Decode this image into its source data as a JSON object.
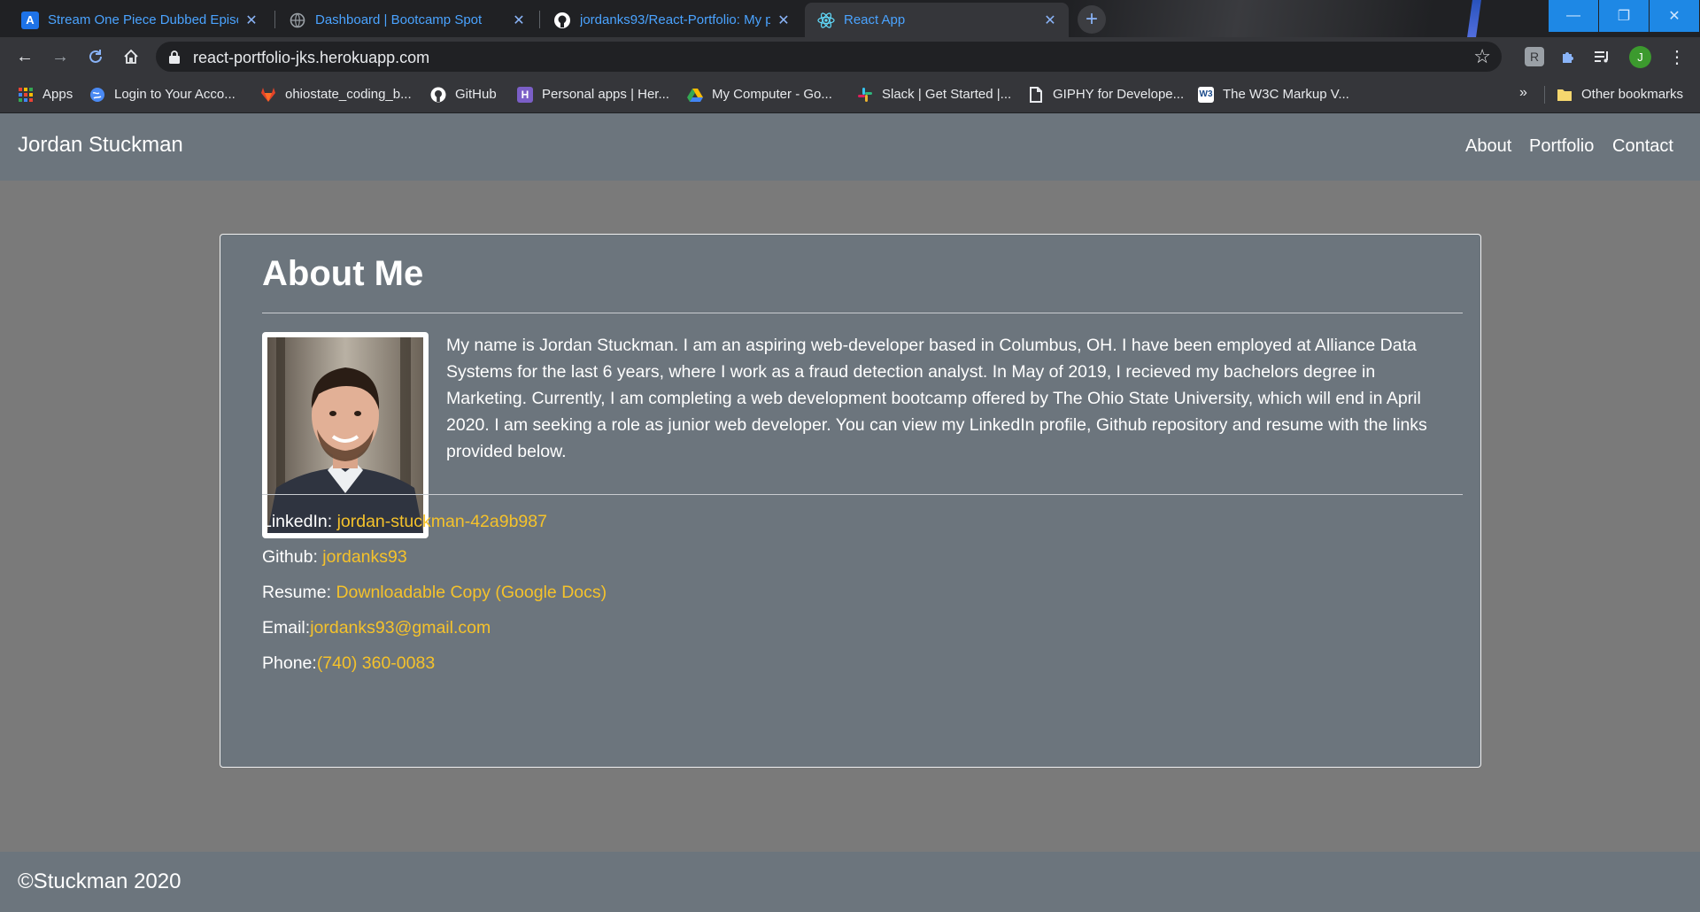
{
  "browser": {
    "tabs": [
      {
        "title": "Stream One Piece Dubbed Episo",
        "favicon": "letter-a-icon",
        "active": false
      },
      {
        "title": "Dashboard | Bootcamp Spot",
        "favicon": "globe-icon",
        "active": false
      },
      {
        "title": "jordanks93/React-Portfolio: My p",
        "favicon": "github-icon",
        "active": false
      },
      {
        "title": "React App",
        "favicon": "react-icon",
        "active": true
      }
    ],
    "new_tab": "+",
    "address": "react-portfolio-jks.herokuapp.com",
    "profile_initial": "J",
    "bookmarks": [
      {
        "label": "Apps",
        "icon": "apps-grid-icon"
      },
      {
        "label": "Login to Your Acco...",
        "icon": "globe-icon"
      },
      {
        "label": "ohiostate_coding_b...",
        "icon": "gitlab-icon"
      },
      {
        "label": "GitHub",
        "icon": "github-icon"
      },
      {
        "label": "Personal apps | Her...",
        "icon": "heroku-icon"
      },
      {
        "label": "My Computer - Go...",
        "icon": "google-drive-icon"
      },
      {
        "label": "Slack | Get Started |...",
        "icon": "slack-icon"
      },
      {
        "label": "GIPHY for Develope...",
        "icon": "giphy-icon"
      },
      {
        "label": "The W3C Markup V...",
        "icon": "w3c-icon"
      }
    ],
    "bookmarks_overflow": "»",
    "other_bookmarks": "Other bookmarks"
  },
  "nav": {
    "brand": "Jordan Stuckman",
    "links": [
      "About",
      "Portfolio",
      "Contact"
    ]
  },
  "about": {
    "title": "About Me",
    "bio": "My name is Jordan Stuckman. I am an aspiring web-developer based in Columbus, OH. I have been employed at Alliance Data Systems for the last 6 years, where I work as a fraud detection analyst. In May of 2019, I recieved my bachelors degree in Marketing. Currently, I am completing a web development bootcamp offered by The Ohio State University, which will end in April 2020. I am seeking a role as junior web developer. You can view my LinkedIn profile, Github repository and resume with the links provided below.",
    "contacts": [
      {
        "label": "LinkedIn: ",
        "value": "jordan-stuckman-42a9b987"
      },
      {
        "label": "Github: ",
        "value": "jordanks93"
      },
      {
        "label": "Resume: ",
        "value": "Downloadable Copy (Google Docs)"
      },
      {
        "label": "Email:",
        "value": "jordanks93@gmail.com"
      },
      {
        "label": "Phone:",
        "value": "(740) 360-0083"
      }
    ]
  },
  "footer": {
    "text": "©Stuckman 2020"
  },
  "colors": {
    "navbar": "#6c757d",
    "page_bg": "#7a7a7a",
    "link": "#f5c22b",
    "tab_text": "#4aa3ff"
  }
}
